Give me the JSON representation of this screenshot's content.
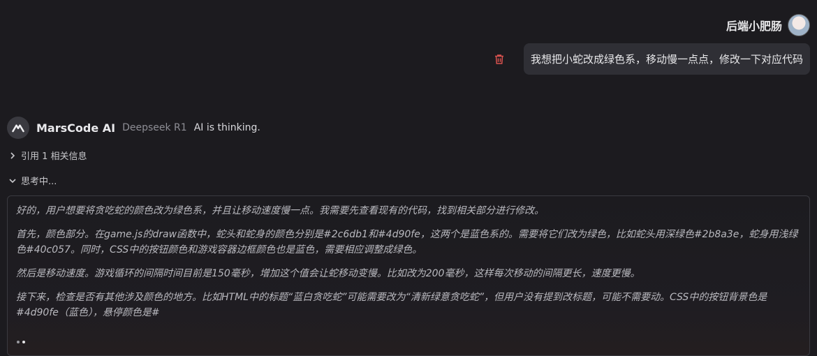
{
  "user": {
    "name": "后端小肥肠",
    "message": "我想把小蛇改成绿色系，移动慢一点点，修改一下对应代码"
  },
  "assistant": {
    "name": "MarsCode AI",
    "model": "Deepseek R1",
    "status": "AI is thinking.",
    "references_label": "引用 1 相关信息",
    "thinking_label": "思考中...",
    "thinking_paragraphs": [
      "好的，用户想要将贪吃蛇的颜色改为绿色系，并且让移动速度慢一点。我需要先查看现有的代码，找到相关部分进行修改。",
      "首先，颜色部分。在game.js的draw函数中，蛇头和蛇身的颜色分别是#2c6db1和#4d90fe，这两个是蓝色系的。需要将它们改为绿色，比如蛇头用深绿色#2b8a3e，蛇身用浅绿色#40c057。同时，CSS中的按钮颜色和游戏容器边框颜色也是蓝色，需要相应调整成绿色。",
      "然后是移动速度。游戏循环的间隔时间目前是150毫秒，增加这个值会让蛇移动变慢。比如改为200毫秒，这样每次移动的间隔更长，速度更慢。",
      "接下来，检查是否有其他涉及颜色的地方。比如HTML中的标题“蓝白贪吃蛇”可能需要改为“清新绿意贪吃蛇”，但用户没有提到改标题，可能不需要动。CSS中的按钮背景色是#4d90fe（蓝色），悬停颜色是#"
    ]
  },
  "icons": {
    "trash": "trash-icon",
    "logo": "marscode-logo-icon",
    "ref_chevron": "chevron-right-icon",
    "think_chevron": "chevron-down-icon"
  },
  "colors": {
    "background": "#1c1b1f",
    "bubble": "#2f2f35",
    "trash": "#d9534f"
  }
}
